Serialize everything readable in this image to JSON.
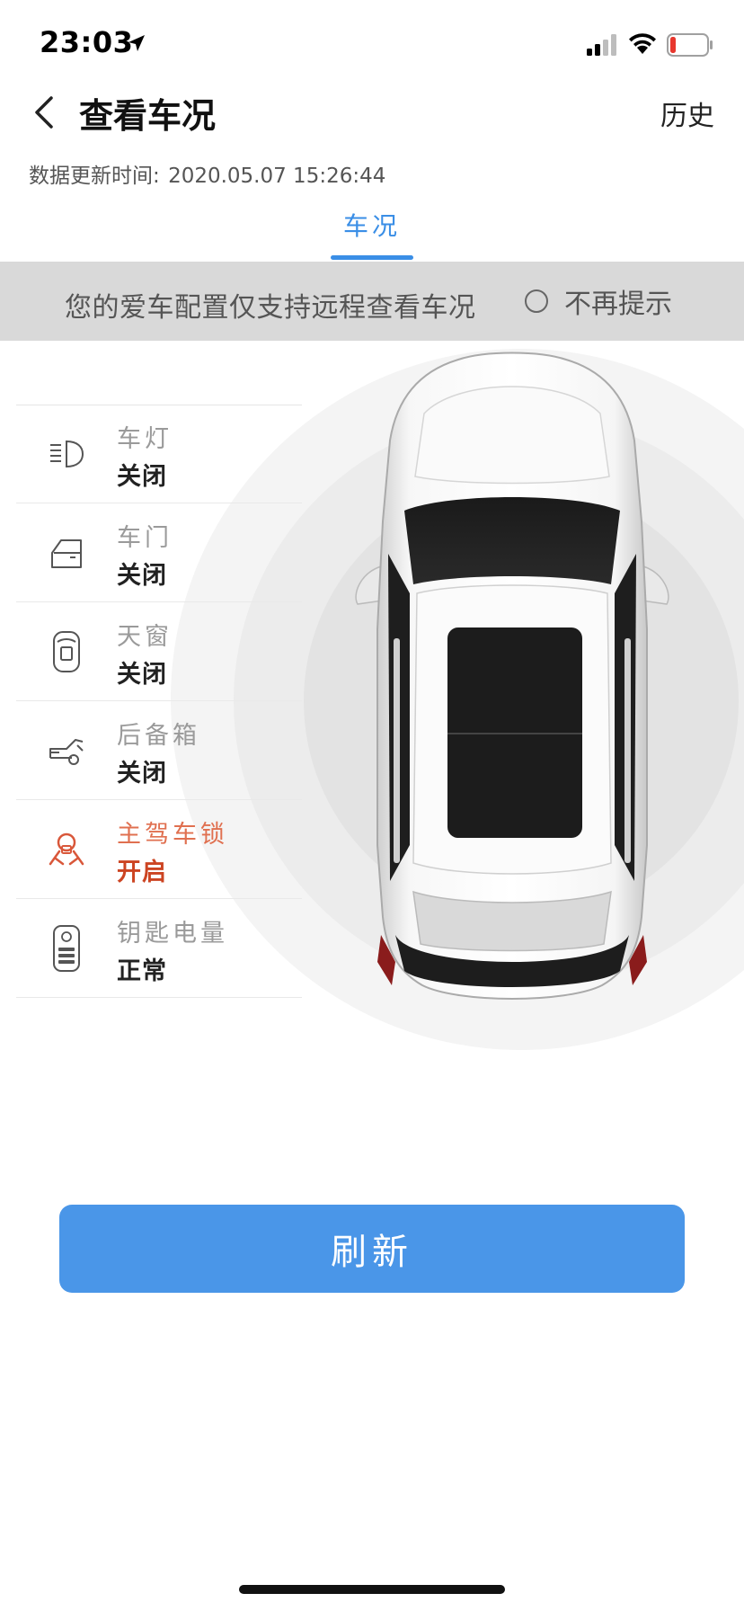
{
  "status_bar": {
    "time": "23:03",
    "icons": [
      "location-arrow-icon",
      "cellular-signal-icon",
      "wifi-icon",
      "battery-low-icon"
    ]
  },
  "nav": {
    "back_icon": "chevron-left-icon",
    "title": "查看车况",
    "history_label": "历史"
  },
  "update": {
    "label": "数据更新时间:",
    "value": "2020.05.07 15:26:44"
  },
  "tabs": [
    {
      "label": "车况",
      "selected": true
    }
  ],
  "notice": {
    "text": "您的爱车配置仅支持远程查看车况",
    "toggle_label": "不再提示",
    "checked": false
  },
  "status_items": [
    {
      "icon": "headlight-icon",
      "label": "车灯",
      "value": "关闭",
      "alert": false
    },
    {
      "icon": "car-door-icon",
      "label": "车门",
      "value": "关闭",
      "alert": false
    },
    {
      "icon": "sunroof-icon",
      "label": "天窗",
      "value": "关闭",
      "alert": false
    },
    {
      "icon": "trunk-icon",
      "label": "后备箱",
      "value": "关闭",
      "alert": false
    },
    {
      "icon": "driver-lock-icon",
      "label": "主驾车锁",
      "value": "开启",
      "alert": true
    },
    {
      "icon": "key-fob-icon",
      "label": "钥匙电量",
      "value": "正常",
      "alert": false
    }
  ],
  "refresh_label": "刷新",
  "colors": {
    "accent": "#3a8ee6",
    "button": "#4a96e8",
    "alert_label": "#e07050",
    "alert_value": "#cc4422",
    "notice_bg": "#d9d9d9"
  }
}
